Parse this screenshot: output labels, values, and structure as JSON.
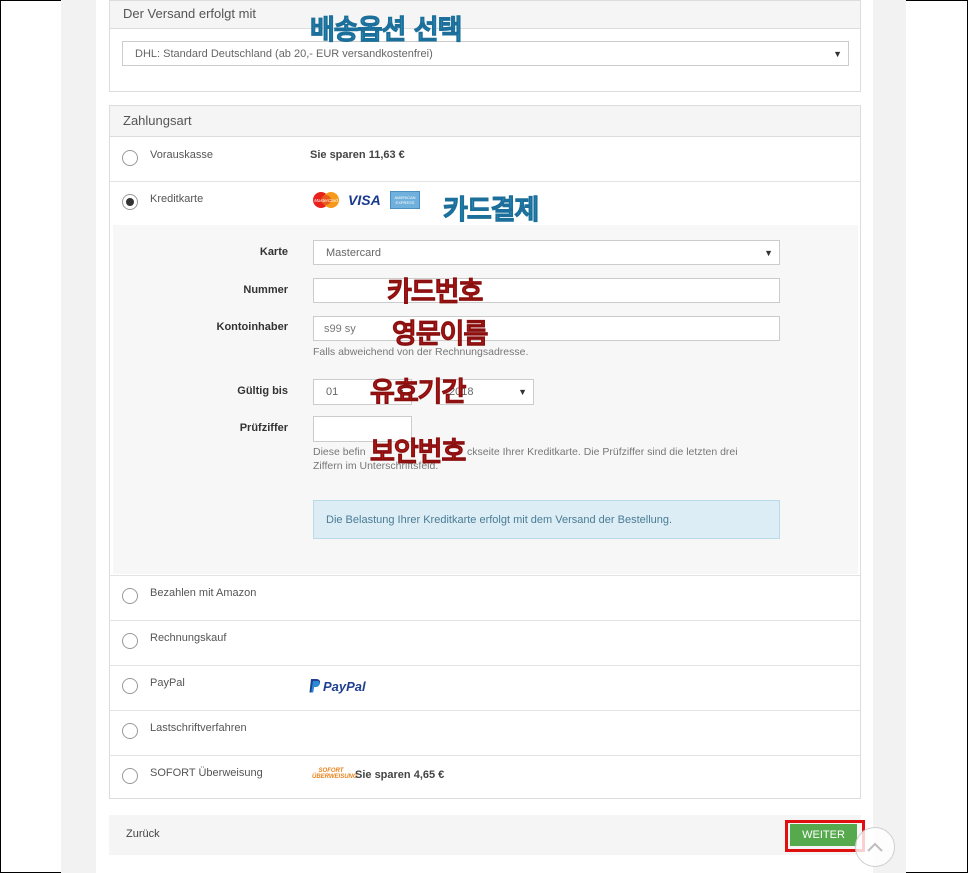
{
  "shipping": {
    "header": "Der Versand erfolgt mit",
    "selected": "DHL: Standard Deutschland (ab 20,- EUR versandkostenfrei)"
  },
  "payment": {
    "header": "Zahlungsart",
    "options": [
      {
        "label": "Vorauskasse",
        "note": "Sie sparen 11,63 €",
        "checked": false
      },
      {
        "label": "Kreditkarte",
        "checked": true,
        "logos": [
          "MasterCard",
          "VISA",
          "AMERICAN EXPRESS"
        ]
      },
      {
        "label": "Bezahlen mit Amazon",
        "checked": false
      },
      {
        "label": "Rechnungskauf",
        "checked": false
      },
      {
        "label": "PayPal",
        "logo": "PayPal",
        "checked": false
      },
      {
        "label": "Lastschriftverfahren",
        "checked": false
      },
      {
        "label": "SOFORT Überweisung",
        "logo": "SOFORT ÜBERWEISUNG",
        "note": "Sie sparen 4,65 €",
        "checked": false
      }
    ]
  },
  "card_form": {
    "karte_label": "Karte",
    "karte_value": "Mastercard",
    "nummer_label": "Nummer",
    "nummer_value": "",
    "inhaber_label": "Kontoinhaber",
    "inhaber_value": "s99 sy",
    "inhaber_help": "Falls abweichend von der Rechnungsadresse.",
    "gueltig_label": "Gültig bis",
    "month_value": "01",
    "year_value": "2018",
    "pruef_label": "Prüfziffer",
    "pruef_value": "",
    "pruef_help_start": "Diese befin",
    "pruef_help_end": "ckseite Ihrer Kreditkarte. Die Prüfziffer sind die letzten drei",
    "pruef_help_line2": "Ziffern im Unterschriftsfeld.",
    "info": "Die Belastung Ihrer Kreditkarte erfolgt mit dem Versand der Bestellung."
  },
  "annotations": {
    "shipping": "배송옵션 선택",
    "card_payment": "카드결제",
    "card_number": "카드번호",
    "english_name": "영문이름",
    "expiry": "유효기간",
    "security_code": "보안번호"
  },
  "footer": {
    "back": "Zurück",
    "next": "WEITER"
  },
  "colors": {
    "accent_green": "#57a94e",
    "highlight_red": "#e01010",
    "info_bg": "#dcedf5"
  }
}
